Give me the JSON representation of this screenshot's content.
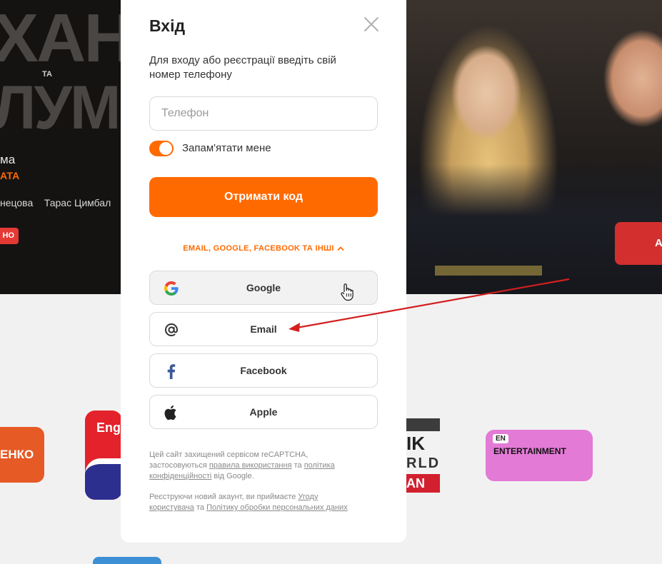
{
  "hero": {
    "title_line1": "ХАНН",
    "title_ta": "ТА",
    "title_line2": "ЛУМ'",
    "genre": "ма",
    "price": "АТА",
    "cast": "нецова    Тарас Цимбал",
    "badge": "НО",
    "cta": "А"
  },
  "channels": {
    "tile1": "ЕНКО",
    "tile2": "Eng",
    "tile3_line1": "IK",
    "tile3_line2": "RLD",
    "tile3_line3": "AN",
    "tile4_badge": "EN",
    "tile4_label": "ENTERTAINMENT"
  },
  "modal": {
    "title": "Вхід",
    "subtitle": "Для входу або реєстрації введіть свій номер телефону",
    "phone_placeholder": "Телефон",
    "remember_label": "Запам'ятати мене",
    "remember_checked": true,
    "get_code_label": "Отримати код",
    "alt_methods_label": "EMAIL, GOOGLE, FACEBOOK ТА ІНШІ",
    "social": [
      {
        "label": "Google",
        "icon": "google-icon"
      },
      {
        "label": "Email",
        "icon": "at-icon"
      },
      {
        "label": "Facebook",
        "icon": "facebook-icon"
      },
      {
        "label": "Apple",
        "icon": "apple-icon"
      }
    ],
    "legal1": {
      "text1": "Цей сайт захищений сервісом reCAPTCHA, застосовуються ",
      "link1": "правила використання",
      "text2": " та ",
      "link2": "політика конфіденційності",
      "text3": " від Google."
    },
    "legal2": {
      "text1": "Реєструючи новий акаунт, ви приймаєте ",
      "link1": "Угоду користувача",
      "text2": " та ",
      "link2": "Політику обробки персональних даних"
    }
  },
  "colors": {
    "accent": "#ff6a00",
    "annotation_arrow": "#d41f1f"
  }
}
